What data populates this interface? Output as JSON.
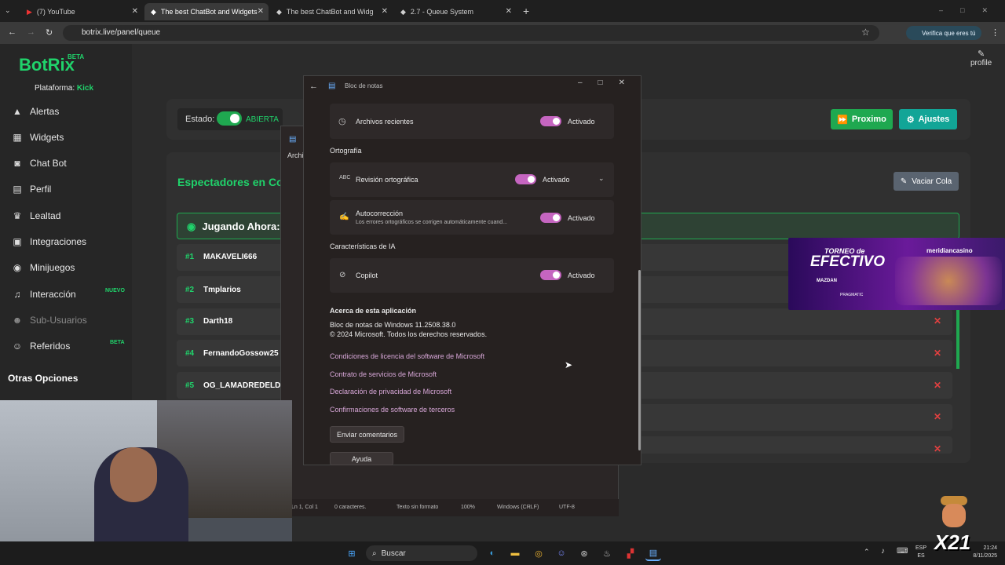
{
  "browser": {
    "tabs": [
      {
        "label": "(7) YouTube"
      },
      {
        "label": "The best ChatBot and Widgets"
      },
      {
        "label": "The best ChatBot and Widg"
      },
      {
        "label": "2.7 - Queue System"
      }
    ],
    "url": "botrix.live/panel/queue",
    "profile_label": "Verifica que eres tú"
  },
  "site": {
    "logo": "BotRix",
    "logo_badge": "BETA",
    "platform_label": "Plataforma:",
    "platform_value": "Kick",
    "profile_link": "profile",
    "sidebar": [
      {
        "label": "Alertas"
      },
      {
        "label": "Widgets"
      },
      {
        "label": "Chat Bot"
      },
      {
        "label": "Perfil"
      },
      {
        "label": "Lealtad"
      },
      {
        "label": "Integraciones"
      },
      {
        "label": "Minijuegos"
      },
      {
        "label": "Interacción",
        "badge": "NUEVO"
      },
      {
        "label": "Sub-Usuarios"
      },
      {
        "label": "Referidos",
        "badge": "BETA"
      }
    ],
    "other_options": "Otras Opciones",
    "estado_label": "Estado:",
    "estado_value": "ABIERTA",
    "btn_next": "Proximo",
    "btn_settings": "Ajustes",
    "queue_title": "Espectadores en Col",
    "btn_clear": "Vaciar Cola",
    "playing_now": "Jugando Ahora:",
    "queue": [
      {
        "num": "#1",
        "name": "MAKAVELI666"
      },
      {
        "num": "#2",
        "name": "Tmplarios"
      },
      {
        "num": "#3",
        "name": "Darth18"
      },
      {
        "num": "#4",
        "name": "FernandoGossow25"
      },
      {
        "num": "#5",
        "name": "OG_LAMADREDELDIA"
      }
    ],
    "accent": "#20d36b"
  },
  "notepad": {
    "title": "Bloc de notas",
    "archivos": "Archivos recientes",
    "activado": "Activado",
    "ortografia_head": "Ortografía",
    "revision": "Revisión ortográfica",
    "autocorreccion": "Autocorrección",
    "autocorreccion_sub": "Los errores ortográficos se corrigen automáticamente cuand...",
    "ia_head": "Características de IA",
    "copilot": "Copilot",
    "about_head": "Acerca de esta aplicación",
    "version": "Bloc de notas de Windows 11.2508.38.0",
    "copyright": "© 2024 Microsoft. Todos los derechos reservados.",
    "links": [
      "Condiciones de licencia del software de Microsoft",
      "Contrato de servicios de Microsoft",
      "Declaración de privacidad de Microsoft",
      "Confirmaciones de software de terceros"
    ],
    "btn_feedback": "Enviar comentarios",
    "btn_help": "Ayuda",
    "behind_label": "Archi",
    "status": [
      "Ln 1, Col 1",
      "0 caracteres.",
      "Texto sin formato",
      "100%",
      "Windows (CRLF)",
      "UTF-8"
    ]
  },
  "ad": {
    "line1": "TORNEO de",
    "line2": "EFECTIVO",
    "brand": "meridiancasino",
    "sponsor1": "MAZDAN",
    "sponsor2": "PRAGMATIC"
  },
  "taskbar": {
    "search": "Buscar",
    "lang1": "ESP",
    "lang2": "ES",
    "time": "21:24",
    "date": "8/11/2025",
    "overlay": "X21"
  }
}
